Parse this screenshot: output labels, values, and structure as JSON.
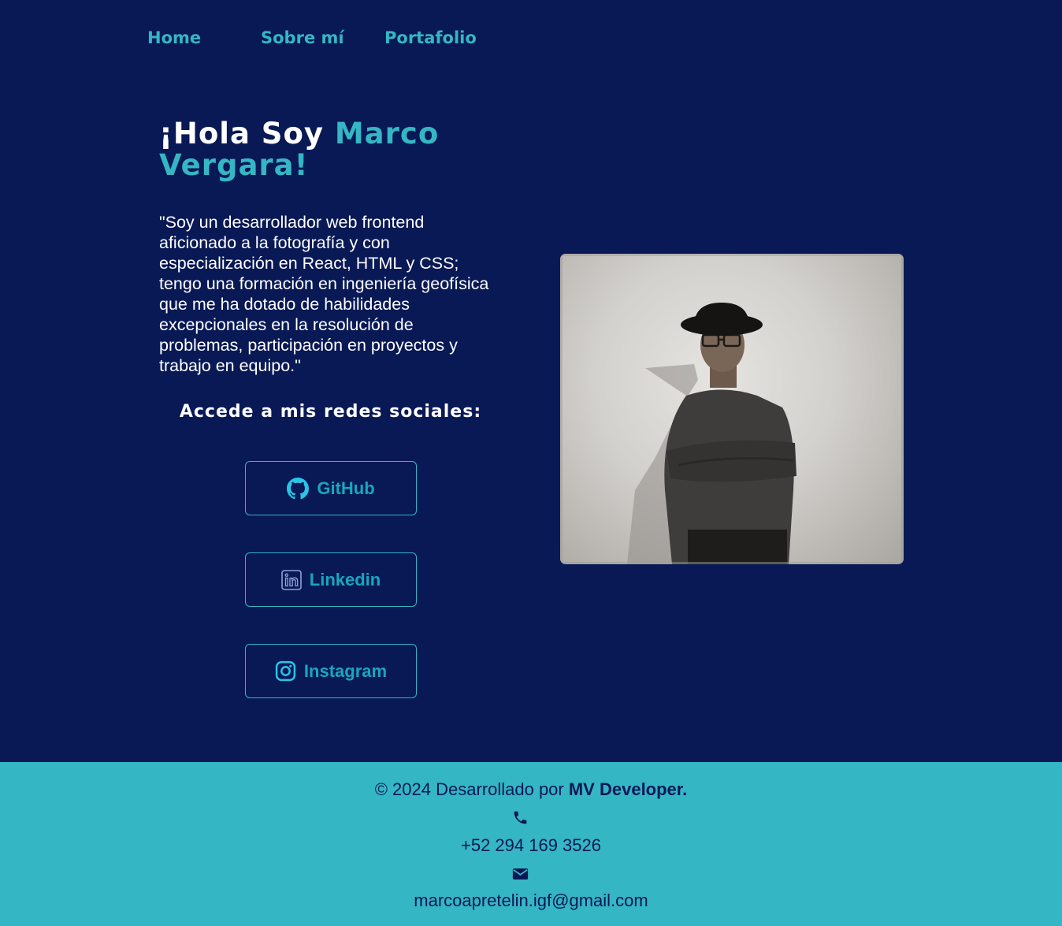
{
  "nav": {
    "items": [
      "Home",
      "Sobre mí",
      "Portafolio"
    ]
  },
  "hero": {
    "title_prefix": "¡Hola Soy ",
    "title_name": "Marco Vergara!",
    "bio": "\"Soy un desarrollador web frontend aficionado a la fotografía y con especialización en React, HTML y CSS; tengo una formación en ingeniería geofísica que me ha dotado de habilidades excepcionales en la resolución de problemas, participación en proyectos y trabajo en equipo.\""
  },
  "social": {
    "heading": "Accede a mis redes sociales:",
    "buttons": [
      {
        "label": "GitHub",
        "icon": "github-icon"
      },
      {
        "label": "Linkedin",
        "icon": "linkedin-icon"
      },
      {
        "label": "Instagram",
        "icon": "instagram-icon"
      }
    ]
  },
  "photo": {
    "alt": "Foto de Marco Vergara",
    "icon": "portrait-photo"
  },
  "footer": {
    "copyright_prefix": "© 2024 Desarrollado por ",
    "brand": "MV Developer.",
    "phone_icon": "phone-icon",
    "phone": "+52 294 169 3526",
    "email_icon": "envelope-icon",
    "email": "marcoapretelin.igf@gmail.com"
  },
  "colors": {
    "background": "#081955",
    "accent": "#35b6c5",
    "button_text": "#17a7be",
    "footer_bg": "#35b6c5",
    "footer_text": "#081955"
  }
}
